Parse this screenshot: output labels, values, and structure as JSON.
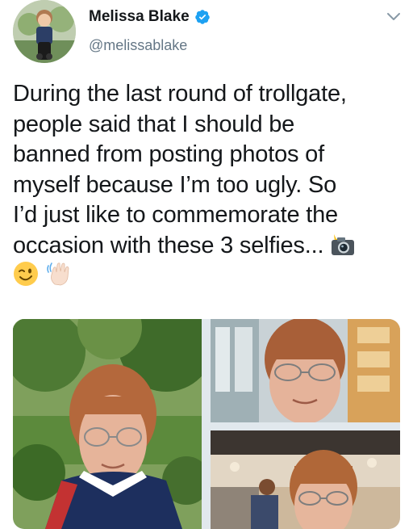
{
  "tweet": {
    "author": {
      "display_name": "Melissa Blake",
      "handle": "@melissablake",
      "verified": true,
      "avatar_icon": "profile-photo"
    },
    "menu_icon": "chevron-down-icon",
    "text_lines": [
      "During the last round of trollgate,",
      "people said that I should be",
      "banned from posting photos of",
      "myself because I’m too ugly. So",
      "I’d just like to commemorate the",
      "occasion with these 3 selfies..."
    ],
    "emojis": [
      "camera-with-flash",
      "winking-face",
      "waving-hand"
    ],
    "media": {
      "count": 3,
      "photos": [
        "selfie-outdoors",
        "selfie-indoors-glass",
        "selfie-restaurant"
      ]
    },
    "colors": {
      "text": "#14171a",
      "secondary": "#657786",
      "verified": "#1da1f2",
      "media_placeholder": "#e1e8ed"
    }
  }
}
